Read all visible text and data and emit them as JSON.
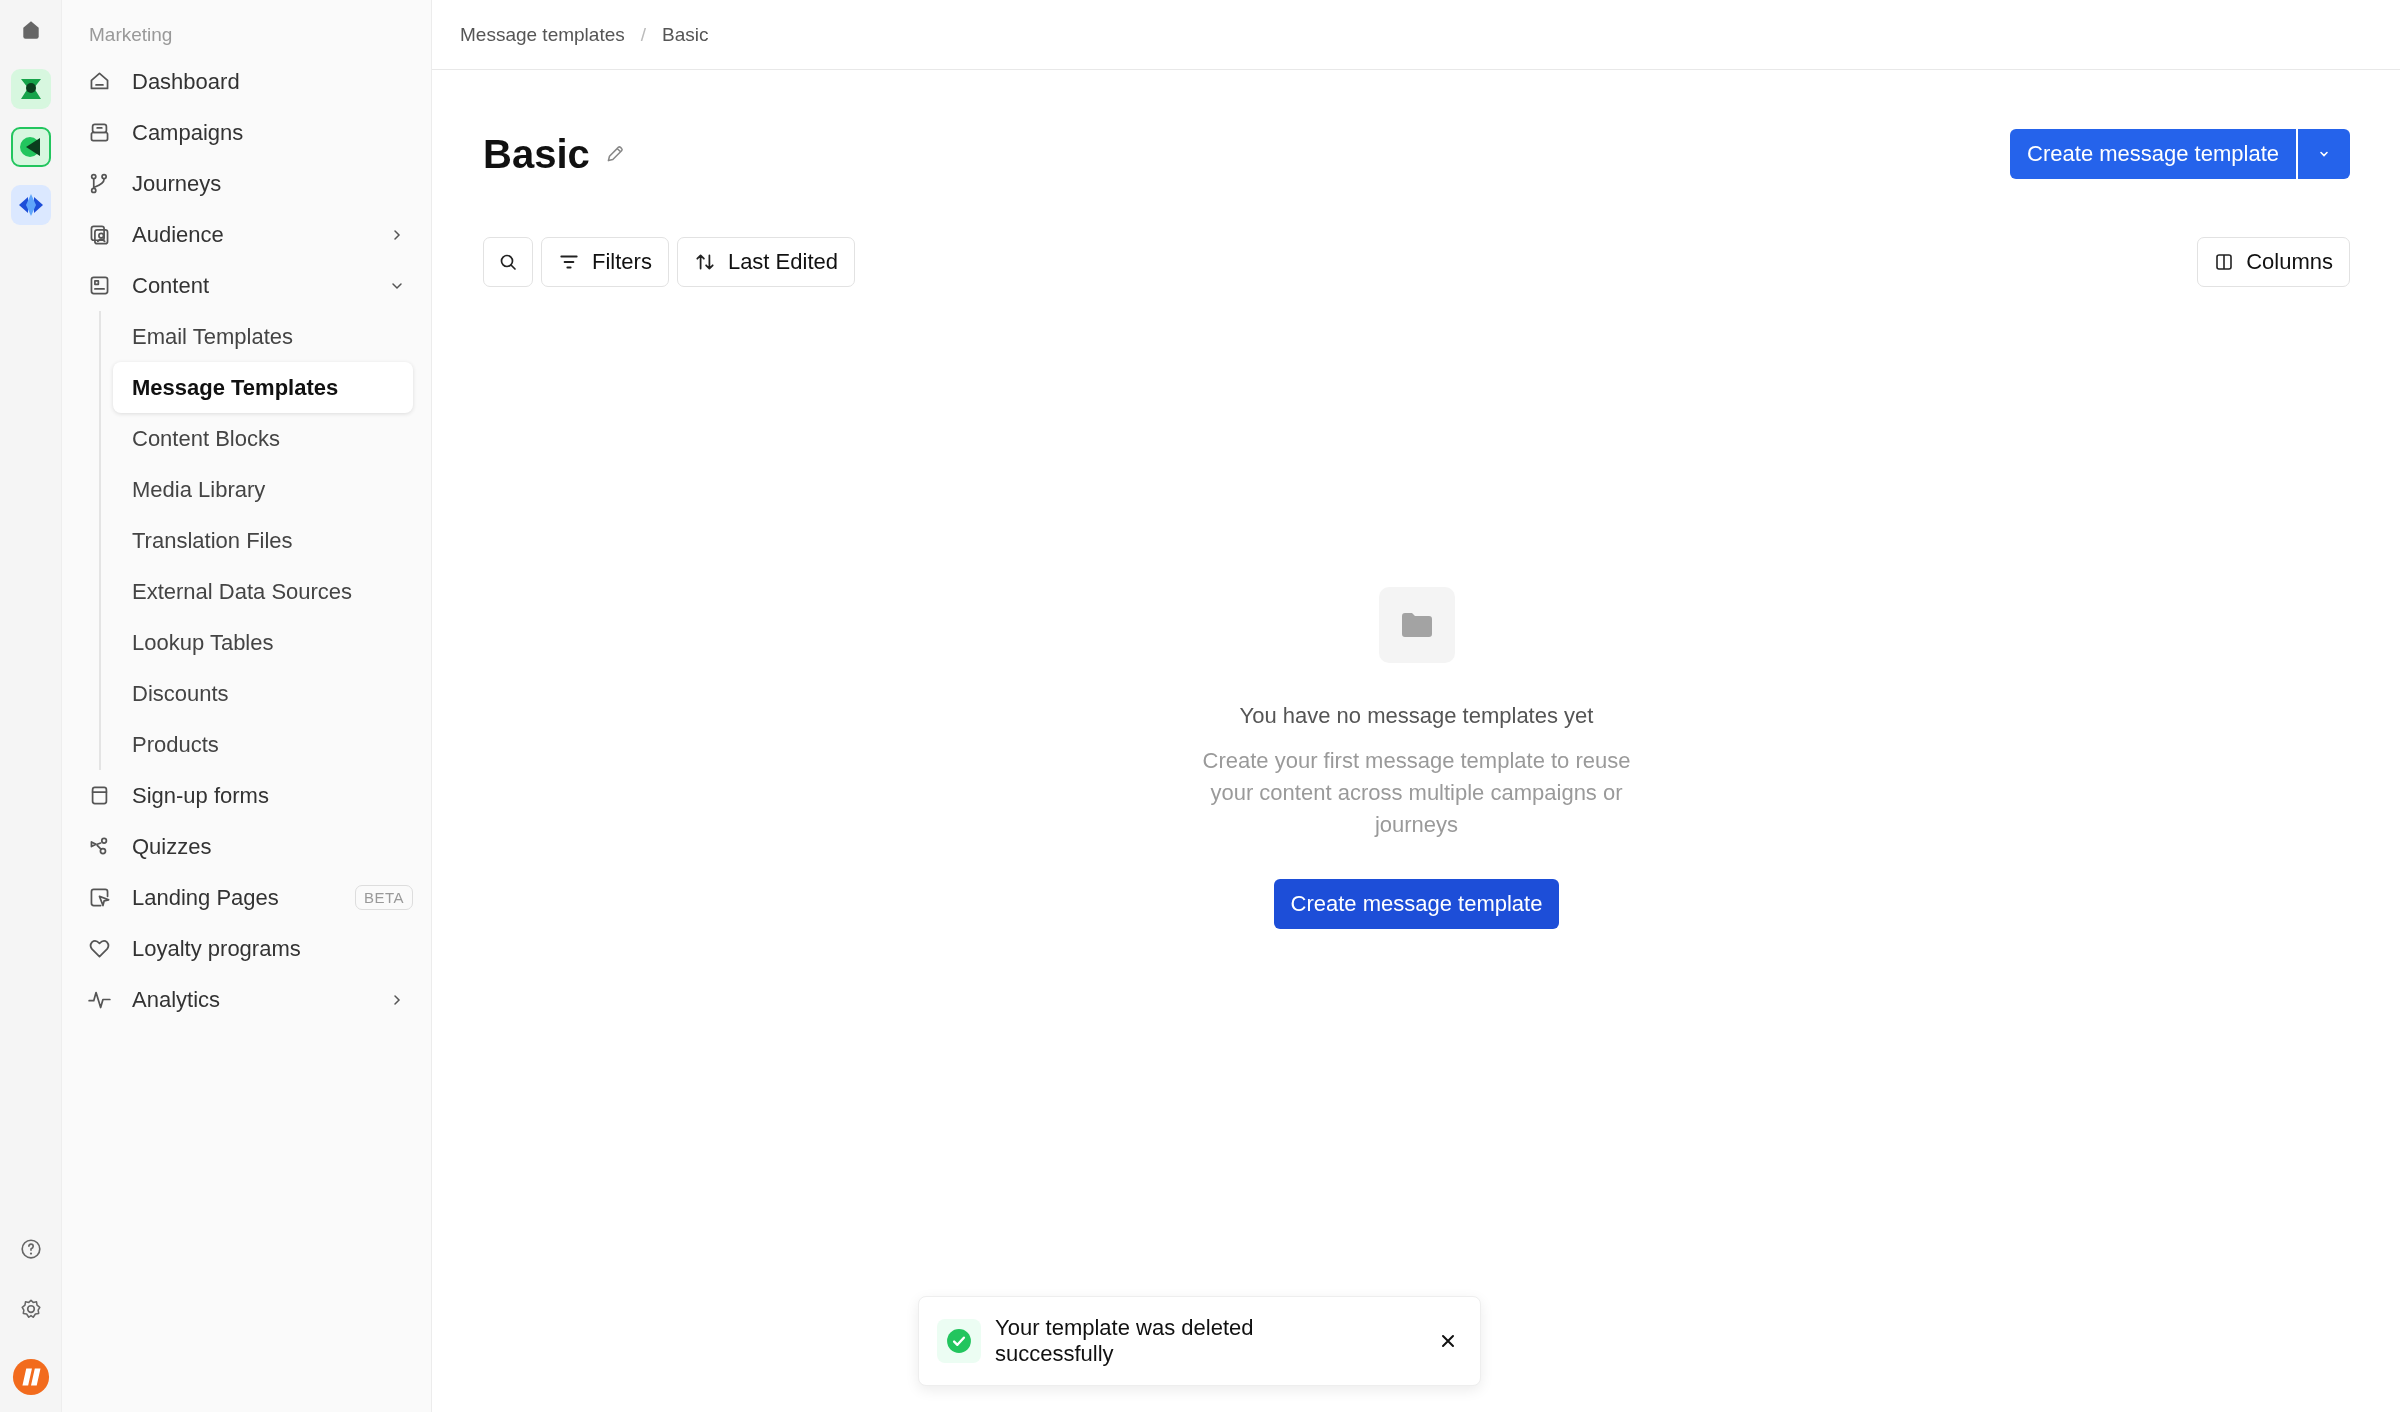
{
  "rail": {
    "apps": [
      {
        "selected": false
      },
      {
        "selected": true
      },
      {
        "selected": false
      }
    ]
  },
  "sidebar": {
    "section": "Marketing",
    "items": [
      {
        "label": "Dashboard"
      },
      {
        "label": "Campaigns"
      },
      {
        "label": "Journeys"
      },
      {
        "label": "Audience",
        "expanded": false
      },
      {
        "label": "Content",
        "expanded": true,
        "children": [
          {
            "label": "Email Templates",
            "selected": false
          },
          {
            "label": "Message Templates",
            "selected": true
          },
          {
            "label": "Content Blocks",
            "selected": false
          },
          {
            "label": "Media Library",
            "selected": false
          },
          {
            "label": "Translation Files",
            "selected": false
          },
          {
            "label": "External Data Sources",
            "selected": false
          },
          {
            "label": "Lookup Tables",
            "selected": false
          },
          {
            "label": "Discounts",
            "selected": false
          },
          {
            "label": "Products",
            "selected": false
          }
        ]
      },
      {
        "label": "Sign-up forms"
      },
      {
        "label": "Quizzes"
      },
      {
        "label": "Landing Pages",
        "badge": "BETA"
      },
      {
        "label": "Loyalty programs"
      },
      {
        "label": "Analytics",
        "expanded": false
      }
    ]
  },
  "breadcrumb": {
    "items": [
      "Message templates",
      "Basic"
    ],
    "separator": "/"
  },
  "page": {
    "title": "Basic",
    "primary_button": "Create message template"
  },
  "toolbar": {
    "filters": "Filters",
    "sort": "Last Edited",
    "columns": "Columns"
  },
  "empty_state": {
    "heading": "You have no message templates yet",
    "description": "Create your first message template to reuse your content across multiple campaigns or journeys",
    "button": "Create message template"
  },
  "toast": {
    "message": "Your template was deleted successfully"
  }
}
